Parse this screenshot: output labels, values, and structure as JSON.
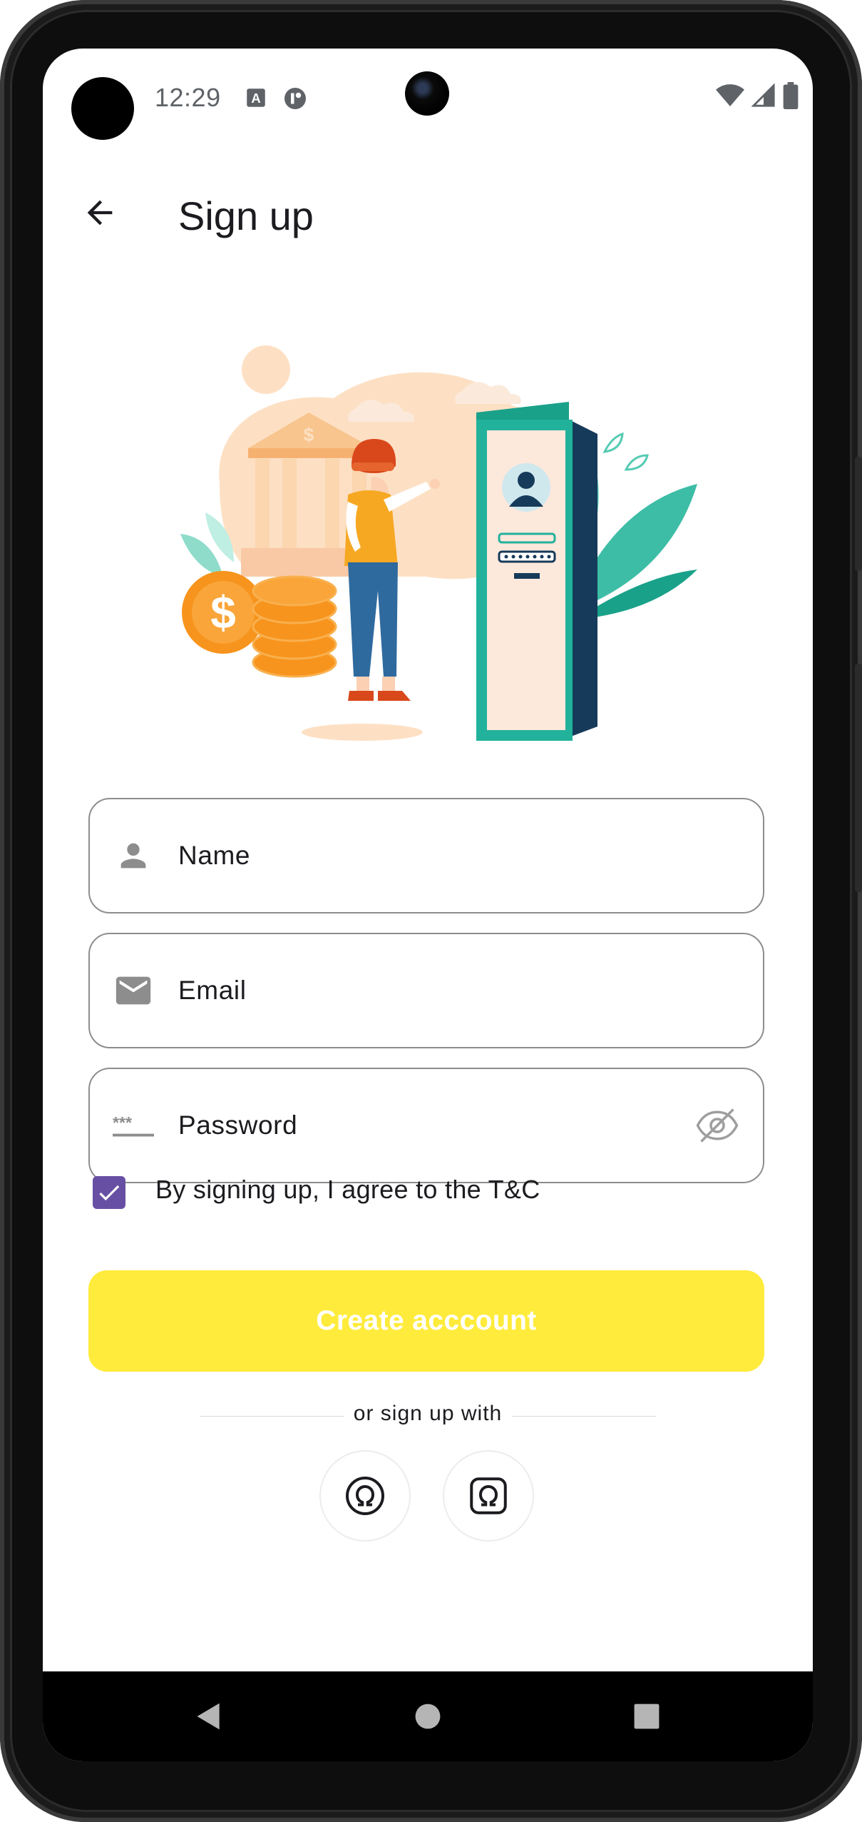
{
  "status_bar": {
    "time": "12:29",
    "icons": [
      "text-a-icon",
      "circle-badge-icon",
      "wifi-icon",
      "signal-icon",
      "battery-icon"
    ]
  },
  "app_bar": {
    "title": "Sign up",
    "back_icon": "arrow-back-icon"
  },
  "form": {
    "name": {
      "placeholder": "Name",
      "icon": "person-icon"
    },
    "email": {
      "placeholder": "Email",
      "icon": "mail-icon"
    },
    "password": {
      "placeholder": "Password",
      "icon": "password-icon",
      "toggle_icon": "visibility-off-icon"
    },
    "terms": {
      "label": "By signing up, I agree to the T&C",
      "checked": true
    }
  },
  "actions": {
    "create_label": "Create acccount",
    "divider_text": "or sign up with",
    "social": [
      "omega-circle-icon",
      "omega-square-icon"
    ]
  },
  "colors": {
    "primary_button": "#ffeb3b",
    "checkbox": "#6750a4",
    "field_border": "#8d8d8d"
  },
  "nav_bar": {
    "icons": [
      "nav-back-icon",
      "nav-home-icon",
      "nav-recents-icon"
    ]
  }
}
